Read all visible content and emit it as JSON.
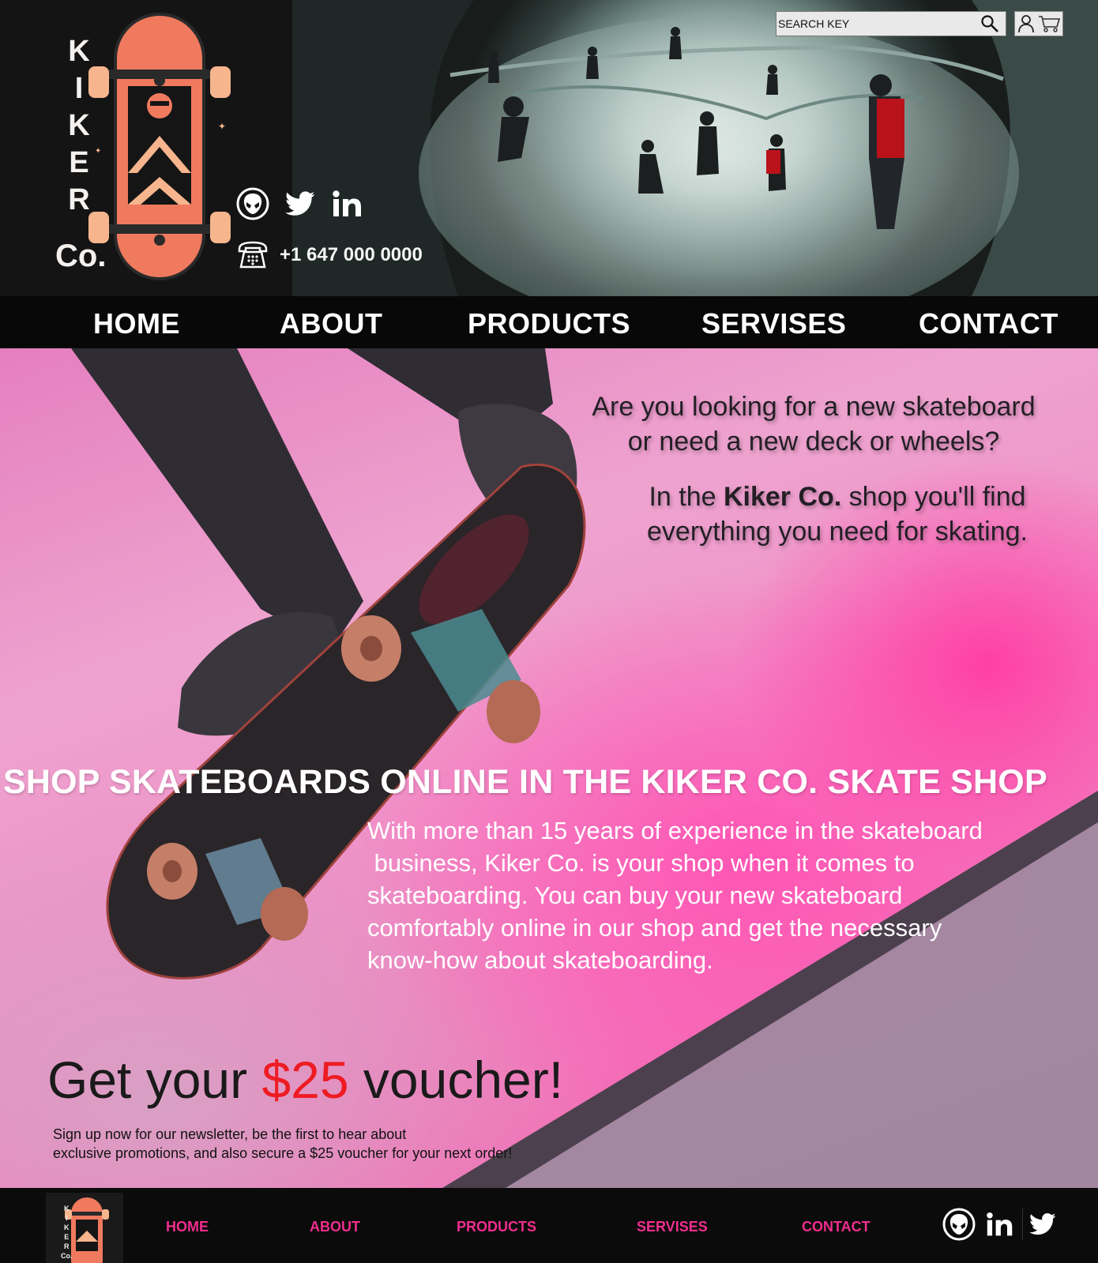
{
  "brand": {
    "logo_letters": [
      "K",
      "I",
      "K",
      "E",
      "R"
    ],
    "logo_suffix": "Co."
  },
  "header": {
    "phone": "+1 647 000 0000",
    "search_placeholder": "SEARCH KEY",
    "social_icons": [
      "alien-icon",
      "twitter-icon",
      "linkedin-icon"
    ]
  },
  "nav": {
    "items": [
      "HOME",
      "ABOUT",
      "PRODUCTS",
      "SERVISES",
      "CONTACT"
    ]
  },
  "main": {
    "intro_line_1": "Are you looking for a new skateboard",
    "intro_line_2": "or need a new deck or wheels?",
    "intro_2_before": "In the ",
    "intro_2_brand": "Kiker Co.",
    "intro_2_after": " shop you'll find",
    "intro_2_line_2": "everything you need for skating.",
    "headline": "SHOP SKATEBOARDS ONLINE IN THE KIKER CO. SKATE SHOP",
    "body_lines": [
      "With more than 15 years of experience in the skateboard",
      " business, Kiker Co. is your shop when it comes to",
      "skateboarding. You can buy your new skateboard",
      "comfortably online in our shop and get the necessary",
      "know-how about skateboarding."
    ],
    "voucher_before": "Get your ",
    "voucher_amount": "$25",
    "voucher_after": " voucher!",
    "voucher_desc_1": "Sign up now for our newsletter, be the first to hear about",
    "voucher_desc_2": "exclusive promotions, and also secure a $25 voucher for your next order!"
  },
  "footer": {
    "items": [
      "HOME",
      "ABOUT",
      "PRODUCTS",
      "SERVISES",
      "CONTACT"
    ],
    "logo_letters": [
      "K",
      "I",
      "K",
      "E",
      "R",
      "Co."
    ],
    "social_icons": [
      "alien-icon",
      "linkedin-icon",
      "twitter-icon"
    ]
  },
  "colors": {
    "accent_pink": "#ef2e8e",
    "voucher_red": "#ee1b22",
    "logo_orange": "#f07a5e",
    "logo_peach": "#f7b58e",
    "bar_dark": "#080808"
  }
}
